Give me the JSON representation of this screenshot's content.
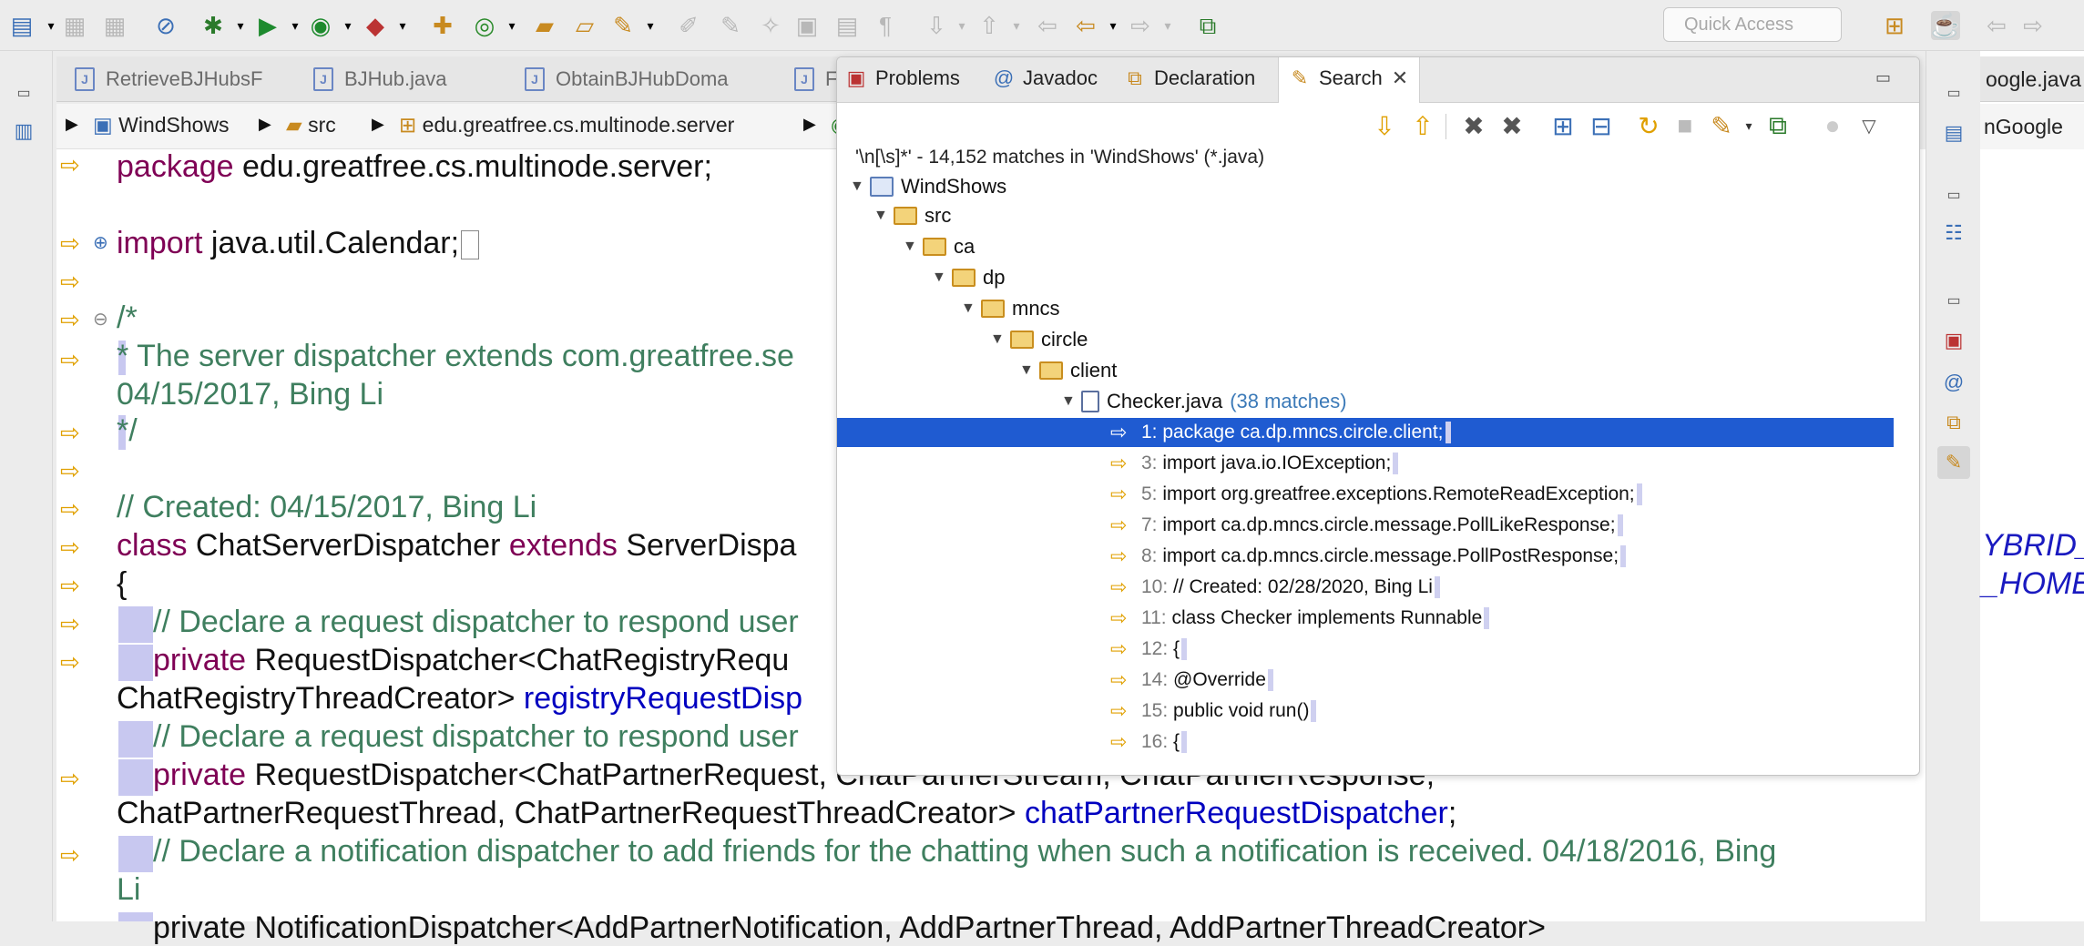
{
  "toolbar": {
    "quick_access_placeholder": "Quick Access"
  },
  "editor_tabs": [
    {
      "label": "RetrieveBJHubsF"
    },
    {
      "label": "BJHub.java"
    },
    {
      "label": "ObtainBJHubDoma"
    },
    {
      "label": "F"
    }
  ],
  "breadcrumb": [
    {
      "label": "WindShows"
    },
    {
      "label": "src"
    },
    {
      "label": "edu.greatfree.cs.multinode.server"
    }
  ],
  "right_breadcrumb": {
    "tab_partial": "oogle.java",
    "crumb_partial": "nGoogle"
  },
  "right_code": {
    "line1": "YBRID_",
    "line2": "_HOME"
  },
  "code": {
    "package_kw": "package",
    "package_name": " edu.greatfree.cs.multinode.server;",
    "import_kw": "import",
    "import_name": " java.util.Calendar;",
    "comment_open": "/*",
    "comment_line1": "* The server dispatcher extends com.greatfree.se",
    "comment_line2": "04/15/2017, Bing Li",
    "comment_close": "*/",
    "created_comment": "// Created: 04/15/2017, Bing Li",
    "class_kw": "class",
    "class_name": " ChatServerDispatcher ",
    "extends_kw": "extends",
    "super_name": " ServerDispa",
    "brace": "{",
    "decl_comment1": "// Declare a request dispatcher to respond user",
    "private_kw1": "private",
    "decl1_type": " RequestDispatcher<ChatRegistryRequ",
    "decl1_cont": "ChatRegistryThreadCreator> ",
    "decl1_field": "registryRequestDisp",
    "decl_comment2": "// Declare a request dispatcher to respond user",
    "private_kw2": "private",
    "decl2_type": " RequestDispatcher<ChatPartnerRequest, ChatPartnerStream, ChatPartnerResponse,",
    "decl2_cont": "ChatPartnerRequestThread, ChatPartnerRequestThreadCreator> ",
    "decl2_field": "chatPartnerRequestDispatcher",
    "decl2_semicolon": ";",
    "decl_comment3": "// Declare a notification dispatcher to add friends for the chatting when such a notification is received. 04/18/2016, Bing",
    "decl_comment3_cont": "Li",
    "bottom_partial": "private NotificationDispatcher<AddPartnerNotification, AddPartnerThread, AddPartnerThreadCreator>"
  },
  "panel": {
    "tabs": [
      {
        "label": "Problems",
        "icon": "problems-icon"
      },
      {
        "label": "Javadoc",
        "icon": "javadoc-icon"
      },
      {
        "label": "Declaration",
        "icon": "declaration-icon"
      },
      {
        "label": "Search",
        "icon": "search-icon",
        "active": true
      }
    ],
    "summary": "'\\n[\\s]*' - 14,152 matches in 'WindShows' (*.java)",
    "tree": {
      "project": "WindShows",
      "folders": [
        "src",
        "ca",
        "dp",
        "mncs",
        "circle",
        "client"
      ],
      "file": "Checker.java",
      "file_count": "(38 matches)"
    },
    "matches": [
      {
        "line": "1:",
        "text": "package ca.dp.mncs.circle.client;",
        "selected": true
      },
      {
        "line": "3:",
        "text": "import java.io.IOException;"
      },
      {
        "line": "5:",
        "text": "import org.greatfree.exceptions.RemoteReadException;"
      },
      {
        "line": "7:",
        "text": "import ca.dp.mncs.circle.message.PollLikeResponse;"
      },
      {
        "line": "8:",
        "text": "import ca.dp.mncs.circle.message.PollPostResponse;"
      },
      {
        "line": "10:",
        "text": "// Created: 02/28/2020, Bing Li"
      },
      {
        "line": "11:",
        "text": "class Checker implements Runnable"
      },
      {
        "line": "12:",
        "text": "{"
      },
      {
        "line": "14:",
        "text": "@Override"
      },
      {
        "line": "15:",
        "text": "public void run()"
      },
      {
        "line": "16:",
        "text": "{"
      }
    ]
  }
}
